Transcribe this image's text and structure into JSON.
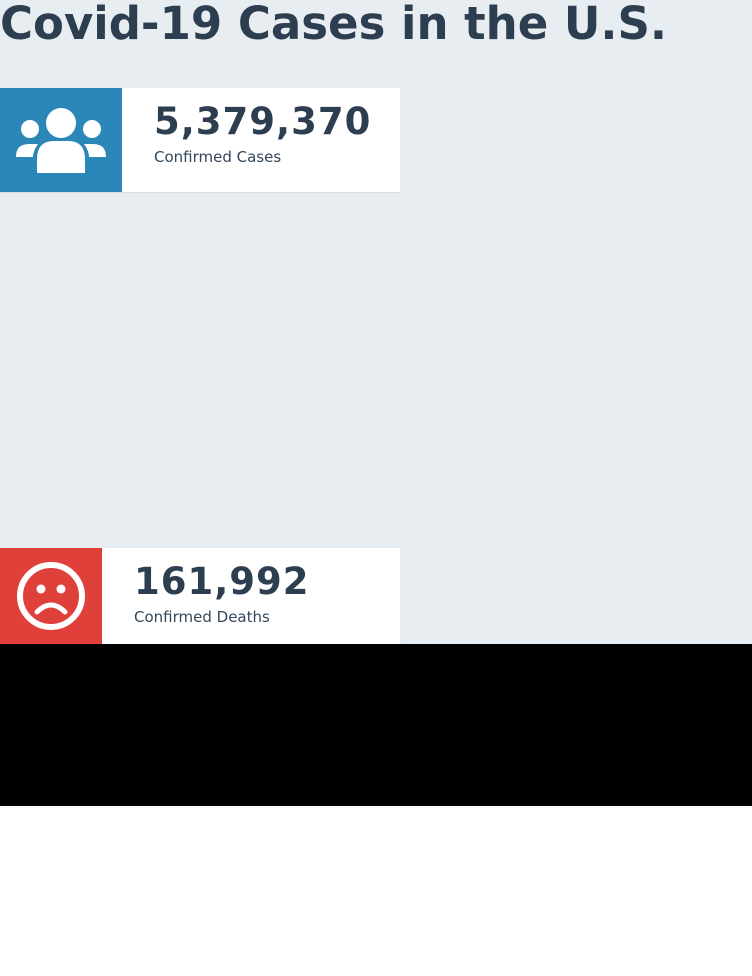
{
  "page": {
    "title": "Covid-19 Cases in the U.S."
  },
  "stats": [
    {
      "value": "5,379,370",
      "label": "Confirmed Cases",
      "icon": "users-icon",
      "color": "#2a87b8"
    },
    {
      "value": "161,992",
      "label": "Confirmed Deaths",
      "icon": "sad-face-icon",
      "color": "#e0403a"
    }
  ],
  "colors": {
    "background": "#e8edf2",
    "text": "#2c3e50"
  }
}
